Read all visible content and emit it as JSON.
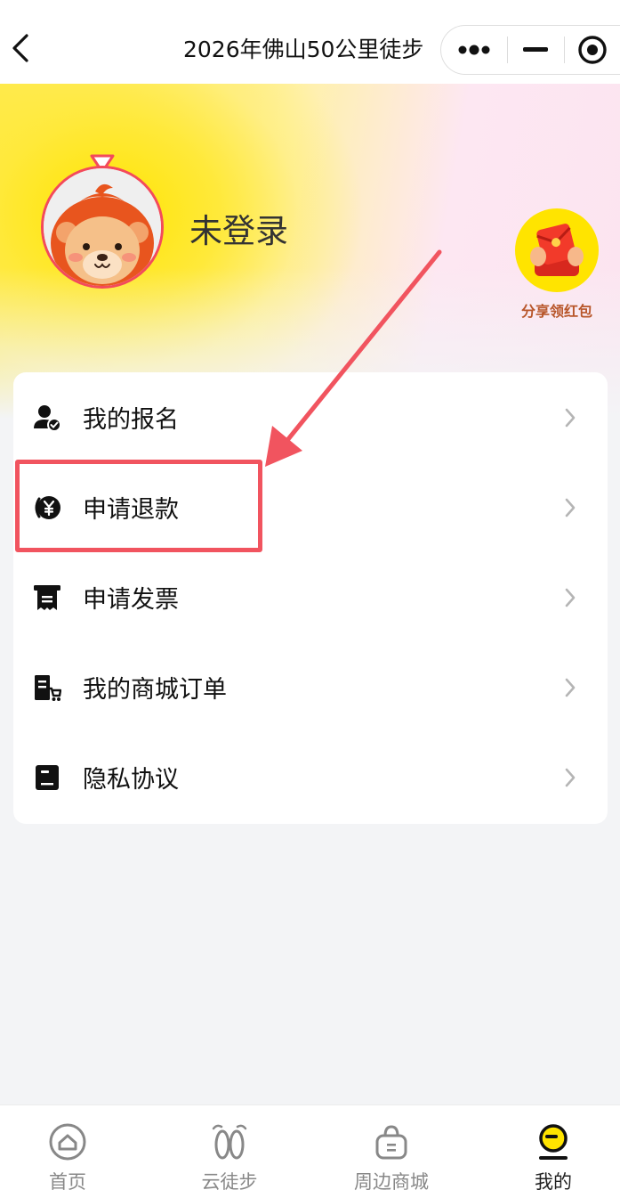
{
  "navbar": {
    "title": "2026年佛山50公里徒步",
    "back_icon": "chevron-left-icon",
    "more_icon": "more-dots-icon",
    "minimize_icon": "minimize-icon",
    "close_icon": "target-close-icon"
  },
  "profile": {
    "username": "未登录",
    "avatar_icon": "lion-mascot-avatar"
  },
  "share": {
    "label": "分享领红包",
    "icon": "red-envelope-icon"
  },
  "menu": {
    "items": [
      {
        "label": "我的报名",
        "icon": "user-check-icon"
      },
      {
        "label": "申请退款",
        "icon": "refund-yen-icon"
      },
      {
        "label": "申请发票",
        "icon": "receipt-icon"
      },
      {
        "label": "我的商城订单",
        "icon": "shop-order-icon"
      },
      {
        "label": "隐私协议",
        "icon": "privacy-doc-icon"
      }
    ]
  },
  "tabbar": {
    "items": [
      {
        "label": "首页",
        "icon": "home-icon",
        "active": false
      },
      {
        "label": "云徒步",
        "icon": "footprints-icon",
        "active": false
      },
      {
        "label": "周边商城",
        "icon": "shopping-bag-icon",
        "active": false
      },
      {
        "label": "我的",
        "icon": "profile-face-icon",
        "active": true
      }
    ]
  },
  "colors": {
    "accent_yellow": "#ffe400",
    "highlight_red": "#f1545f",
    "avatar_ring": "#f34a5b",
    "share_text": "#b8562a"
  }
}
